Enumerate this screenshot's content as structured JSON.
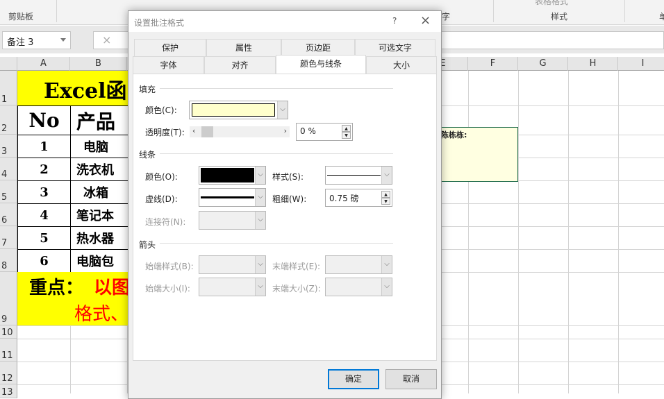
{
  "ribbon": {
    "groups": [
      "剪贴板",
      "字",
      "表格格式",
      "样式",
      "单"
    ]
  },
  "formula_bar": {
    "name_box": "备注 3",
    "cancel_icon": "×"
  },
  "sheet": {
    "columns": [
      "A",
      "B",
      "E",
      "F",
      "G",
      "H",
      "I"
    ],
    "rows": [
      "1",
      "2",
      "3",
      "4",
      "5",
      "6",
      "7",
      "8",
      "9",
      "10",
      "11",
      "12",
      "13"
    ],
    "title": "Excel函",
    "header": {
      "no": "No",
      "product": "产品"
    },
    "items": [
      {
        "no": "1",
        "product": "电脑"
      },
      {
        "no": "2",
        "product": "洗衣机"
      },
      {
        "no": "3",
        "product": "冰箱"
      },
      {
        "no": "4",
        "product": "笔记本"
      },
      {
        "no": "5",
        "product": "热水器"
      },
      {
        "no": "6",
        "product": "电脑包"
      }
    ],
    "note_label": "重点：",
    "note_red1": "以图",
    "note_red2": "格式、",
    "comment_author": "陈栋栋:"
  },
  "dialog": {
    "title": "设置批注格式",
    "help": "?",
    "close": "×",
    "tabs_row1": [
      "保护",
      "属性",
      "页边距",
      "可选文字"
    ],
    "tabs_row2": [
      "字体",
      "对齐",
      "颜色与线条",
      "大小"
    ],
    "active_tab": "颜色与线条",
    "fill": {
      "section": "填充",
      "color_label": "颜色(C):",
      "color_value": "#ffffcc",
      "transparency_label": "透明度(T):",
      "transparency_value": "0 %",
      "transparency": 0
    },
    "line": {
      "section": "线条",
      "color_label": "颜色(O):",
      "color_value": "#000000",
      "style_label": "样式(S):",
      "dash_label": "虚线(D):",
      "weight_label": "粗细(W):",
      "weight_value": "0.75 磅",
      "connector_label": "连接符(N):"
    },
    "arrows": {
      "section": "箭头",
      "begin_style": "始端样式(B):",
      "end_style": "末端样式(E):",
      "begin_size": "始端大小(I):",
      "end_size": "末端大小(Z):"
    },
    "ok": "确定",
    "cancel": "取消"
  }
}
